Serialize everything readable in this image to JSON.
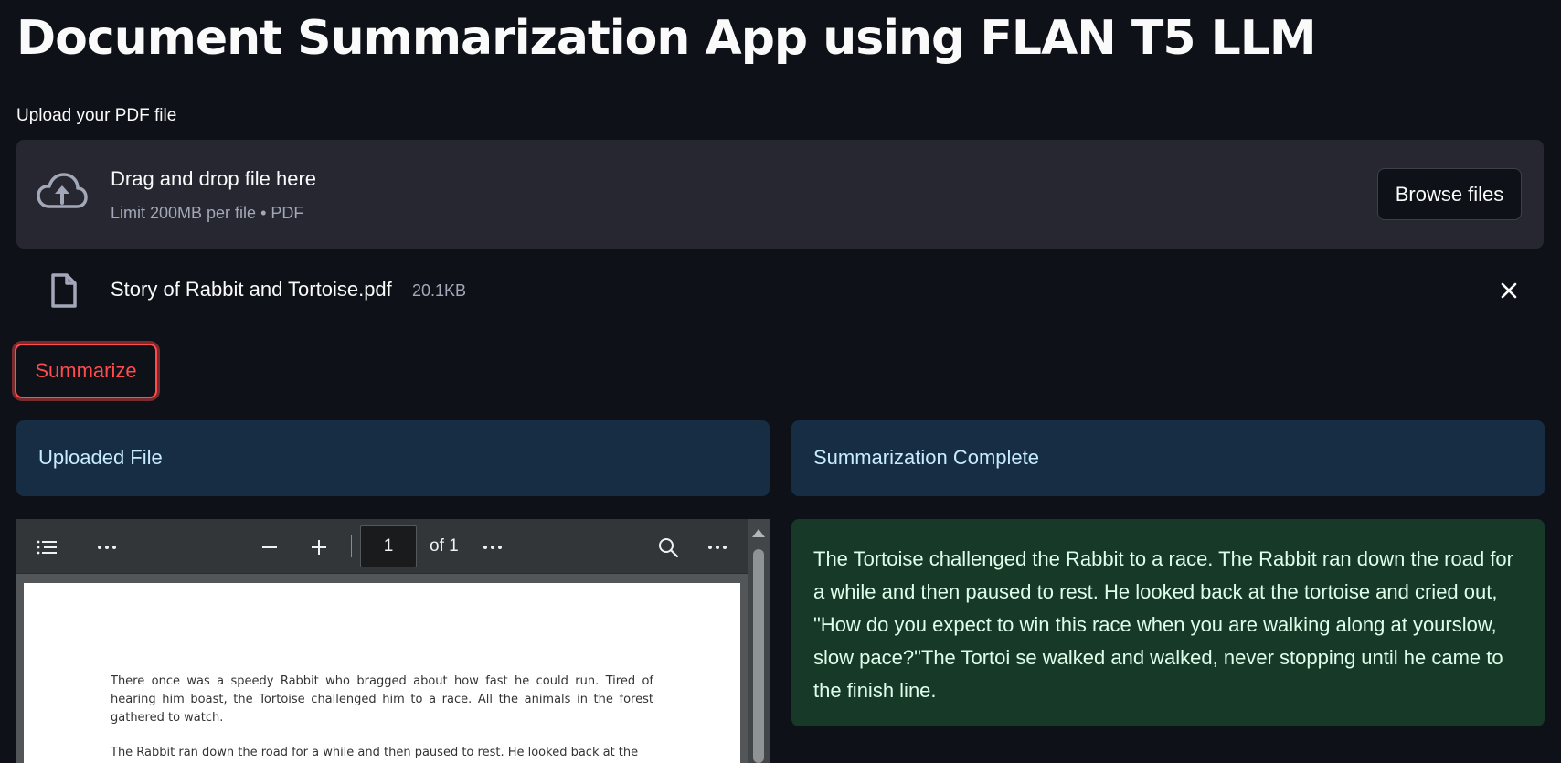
{
  "app": {
    "title": "Document Summarization App using FLAN T5 LLM"
  },
  "uploader": {
    "label": "Upload your PDF file",
    "drop_text": "Drag and drop file here",
    "limit_text": "Limit 200MB per file • PDF",
    "browse_label": "Browse files",
    "icon": "cloud-upload-icon"
  },
  "uploaded_file": {
    "name": "Story of Rabbit and Tortoise.pdf",
    "size": "20.1KB",
    "icon": "file-icon"
  },
  "actions": {
    "summarize_label": "Summarize"
  },
  "left_column": {
    "header": "Uploaded File"
  },
  "right_column": {
    "header": "Summarization Complete",
    "summary": "The Tortoise challenged the Rabbit to a race. The Rabbit ran down the road for a while and then paused to rest. He looked back at the tortoise and cried out, \"How do you expect to win this race when you are walking along at yourslow, slow pace?\"The Tortoi se walked and walked, never stopping until he came to the finish line."
  },
  "pdf_viewer": {
    "page_number": "1",
    "page_total": "of 1",
    "paragraphs": [
      "There once was a speedy Rabbit who bragged about how fast he could run. Tired of hearing him boast, the Tortoise challenged him to a race. All the animals in the forest gathered to watch.",
      "The Rabbit ran down the road for a while and then paused to rest. He looked back at the"
    ]
  },
  "colors": {
    "background": "#0e1117",
    "accent": "#ff4b4b",
    "info_bg": "#172d43",
    "success_bg": "#173928"
  }
}
